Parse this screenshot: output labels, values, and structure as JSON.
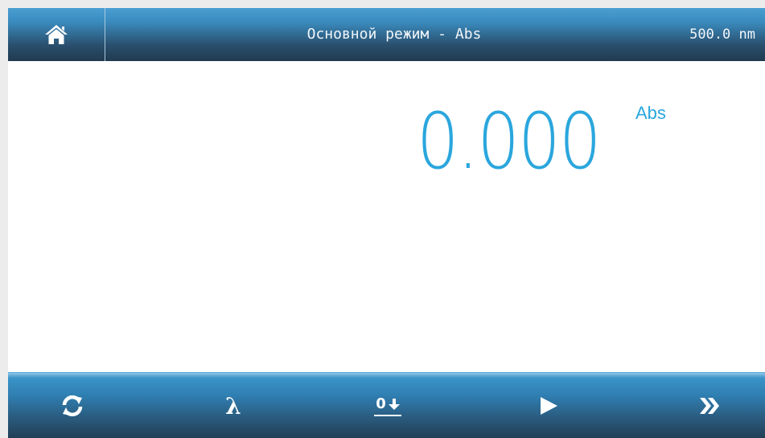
{
  "header": {
    "home_icon": "home-icon",
    "title": "Основной режим - Abs",
    "wavelength": "500.0 nm"
  },
  "measurement": {
    "value": "0.000",
    "unit": "Abs",
    "color": "#2aa6dd"
  },
  "toolbar": {
    "buttons": [
      {
        "icon": "refresh-icon"
      },
      {
        "icon": "lambda-icon",
        "label": "λ"
      },
      {
        "icon": "zero-icon",
        "label": "0"
      },
      {
        "icon": "play-icon"
      },
      {
        "icon": "forward-icon"
      }
    ]
  },
  "colors": {
    "accent": "#2aa6dd",
    "header_top": "#4a9fd2",
    "header_bottom": "#203a50"
  }
}
